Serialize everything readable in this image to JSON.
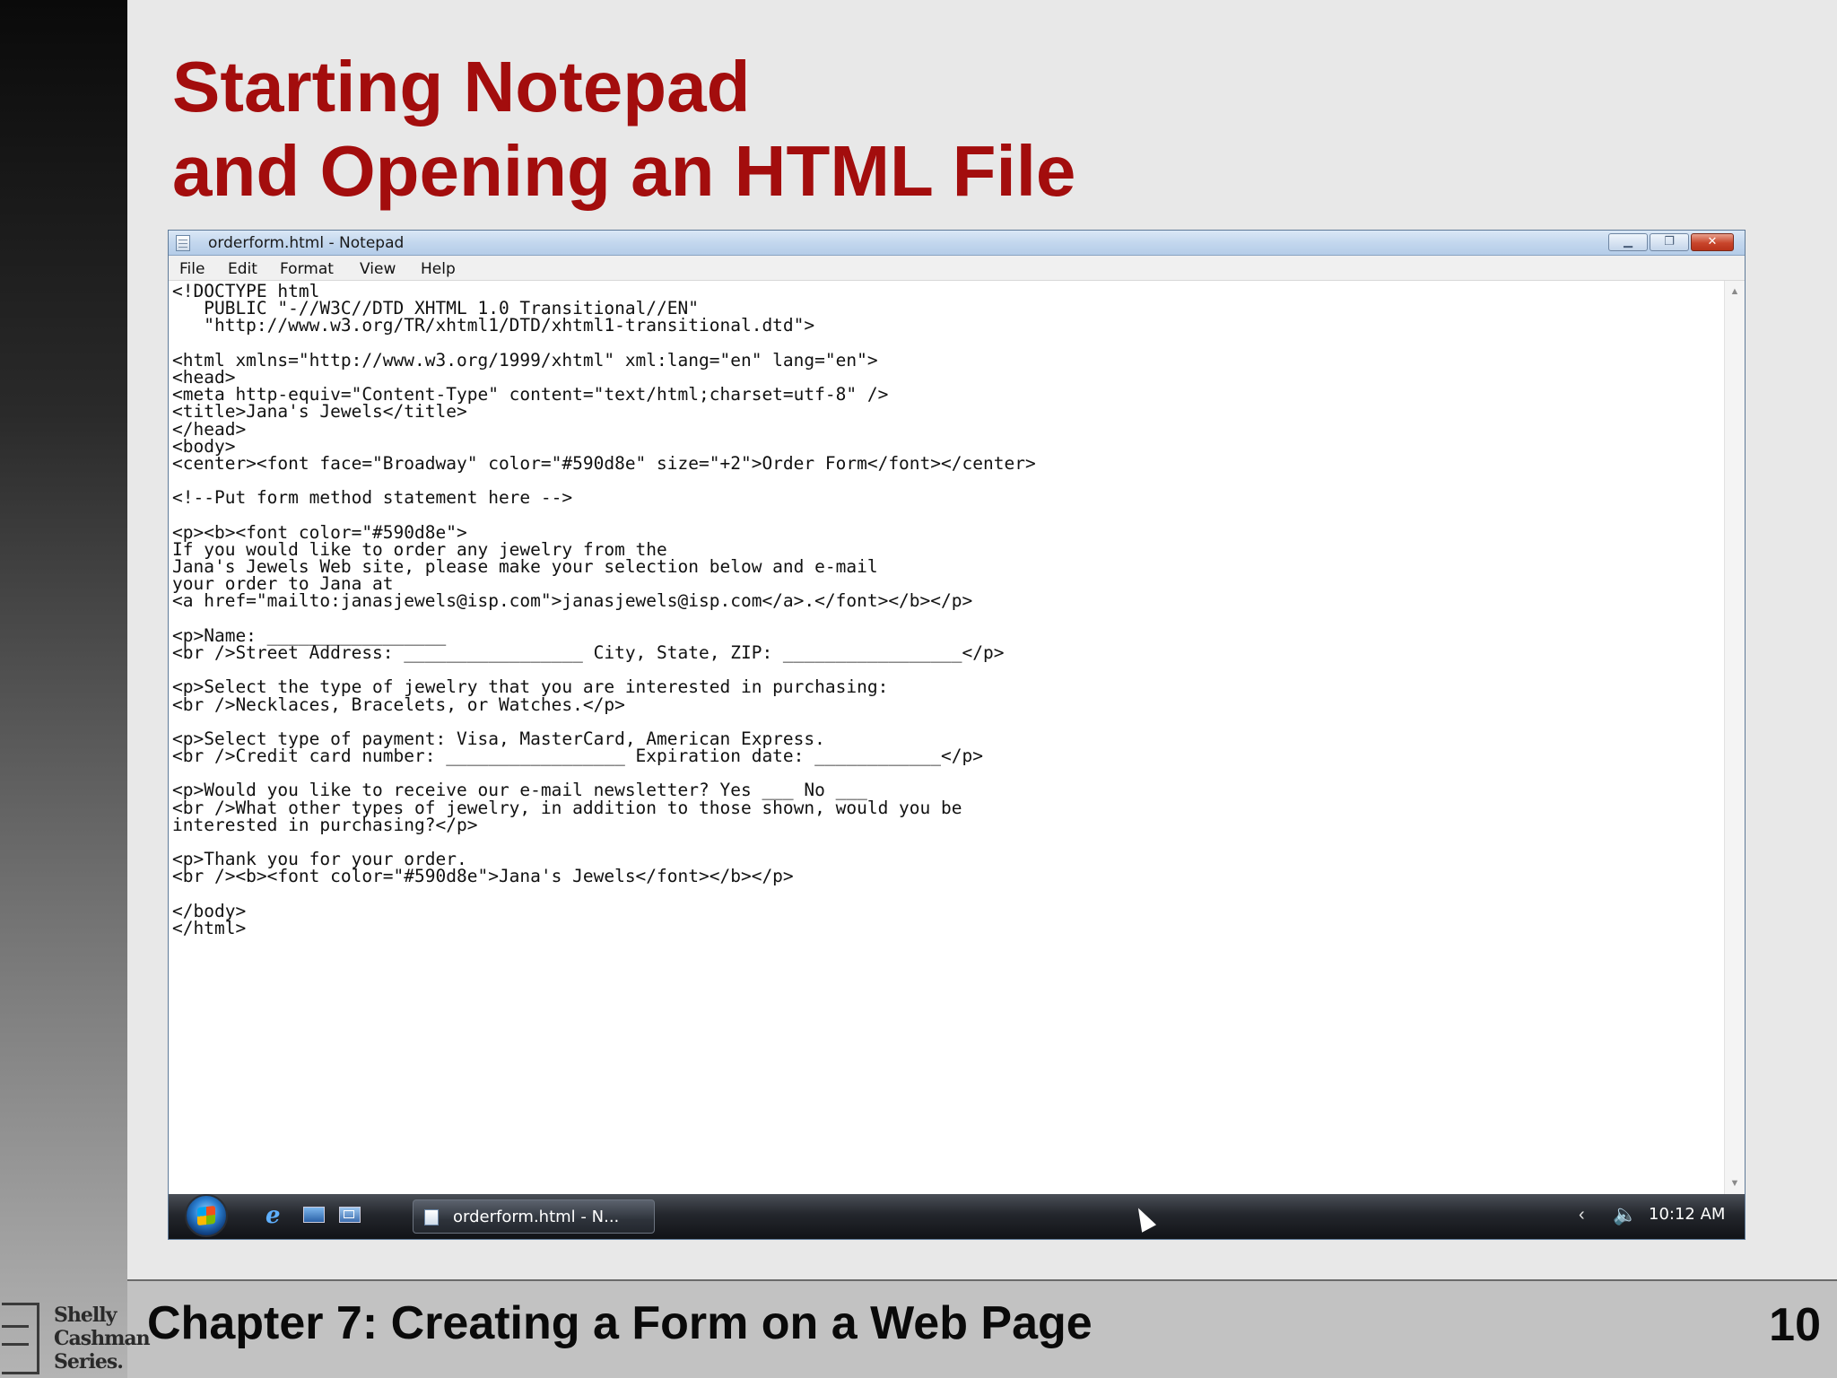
{
  "slide": {
    "title_line1": "Starting Notepad",
    "title_line2": "and Opening an HTML File",
    "footer": "Chapter 7: Creating a Form on a Web Page",
    "page_number": "10",
    "logo_lines": [
      "Shelly",
      "Cashman",
      "Series."
    ]
  },
  "notepad": {
    "title": "orderform.html - Notepad",
    "menu": [
      "File",
      "Edit",
      "Format",
      "View",
      "Help"
    ],
    "lines": [
      "<!DOCTYPE html",
      "   PUBLIC \"-//W3C//DTD XHTML 1.0 Transitional//EN\"",
      "   \"http://www.w3.org/TR/xhtml1/DTD/xhtml1-transitional.dtd\">",
      "",
      "<html xmlns=\"http://www.w3.org/1999/xhtml\" xml:lang=\"en\" lang=\"en\">",
      "<head>",
      "<meta http-equiv=\"Content-Type\" content=\"text/html;charset=utf-8\" />",
      "<title>Jana's Jewels</title>",
      "</head>",
      "<body>",
      "<center><font face=\"Broadway\" color=\"#590d8e\" size=\"+2\">Order Form</font></center>",
      "",
      "<!--Put form method statement here -->",
      "",
      "<p><b><font color=\"#590d8e\">",
      "If you would like to order any jewelry from the",
      "Jana's Jewels Web site, please make your selection below and e-mail",
      "your order to Jana at",
      "<a href=\"mailto:janasjewels@isp.com\">janasjewels@isp.com</a>.</font></b></p>",
      "",
      "<p>Name: _________________",
      "<br />Street Address: _________________ City, State, ZIP: _________________</p>",
      "",
      "<p>Select the type of jewelry that you are interested in purchasing:",
      "<br />Necklaces, Bracelets, or Watches.</p>",
      "",
      "<p>Select type of payment: Visa, MasterCard, American Express.",
      "<br />Credit card number: _________________ Expiration date: ____________</p>",
      "",
      "<p>Would you like to receive our e-mail newsletter? Yes ___ No ___",
      "<br />What other types of jewelry, in addition to those shown, would you be",
      "interested in purchasing?</p>",
      "",
      "<p>Thank you for your order.",
      "<br /><b><font color=\"#590d8e\">Jana's Jewels</font></b></p>",
      "",
      "</body>",
      "</html>"
    ]
  },
  "taskbar": {
    "task_button_label": "orderform.html - N...",
    "clock": "10:12 AM"
  },
  "colors": {
    "title_red": "#a30d0d",
    "taskbar_dark": "#1a1d22"
  }
}
